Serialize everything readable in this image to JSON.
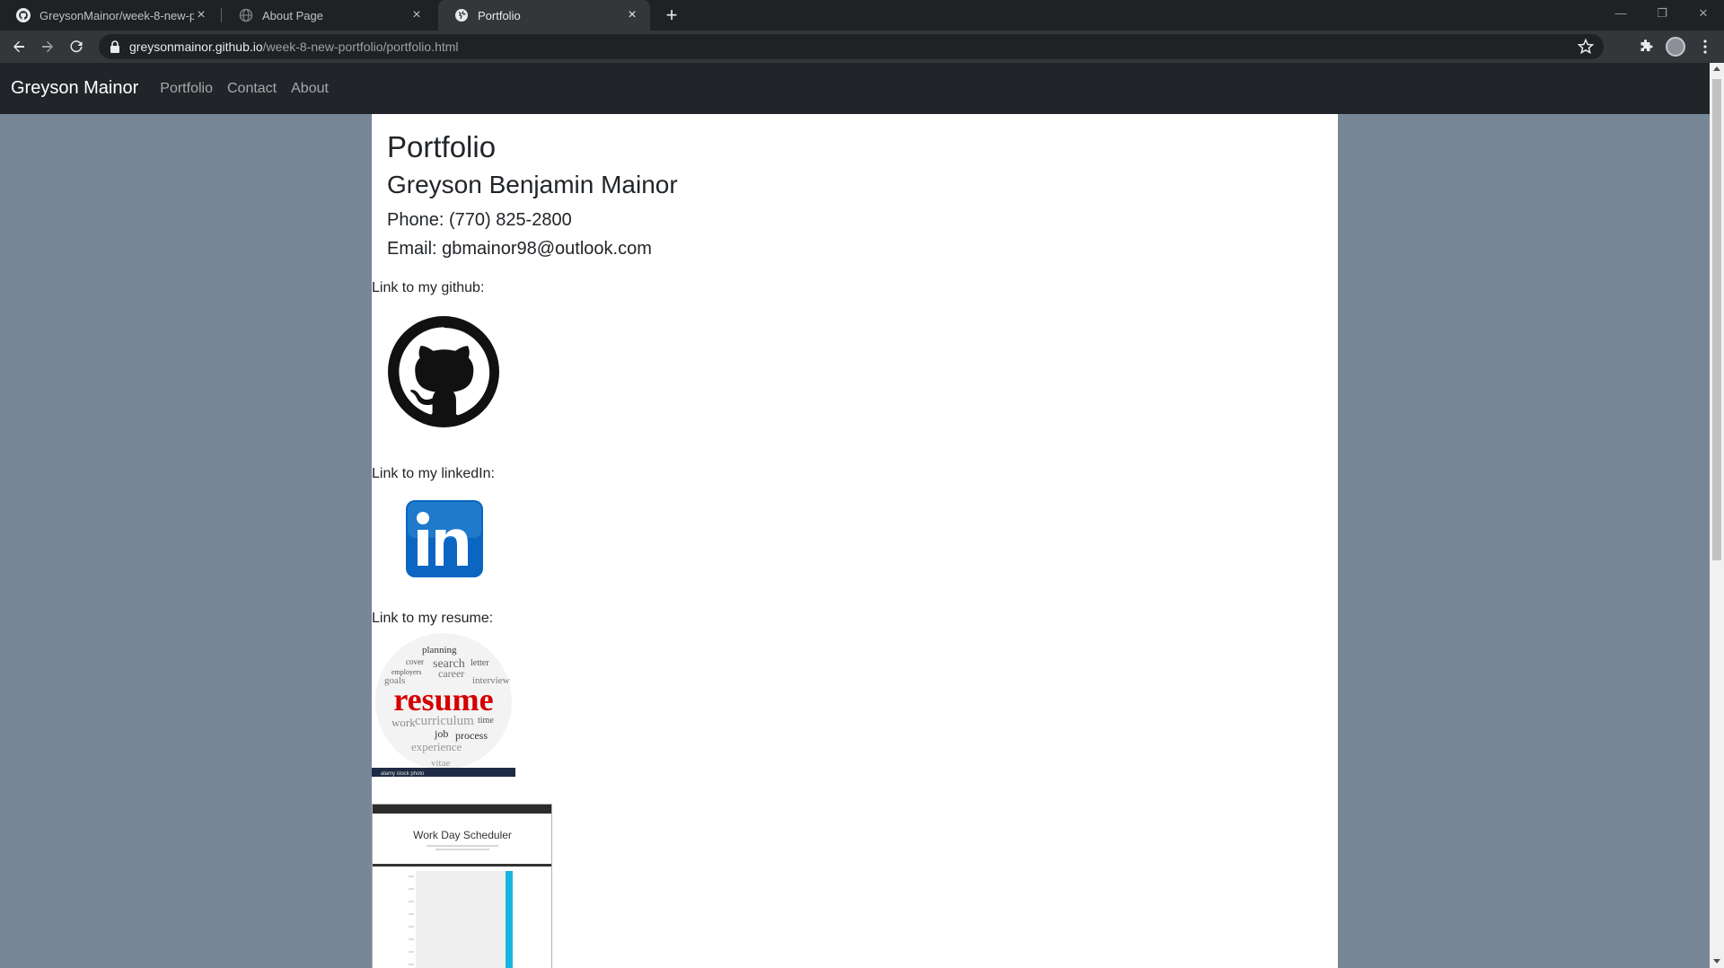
{
  "browser": {
    "tabs": [
      {
        "title": "GreysonMainor/week-8-new-portfolio",
        "icon": "github-icon"
      },
      {
        "title": "About Page",
        "icon": "globe-icon"
      },
      {
        "title": "Portfolio",
        "icon": "globe-icon"
      }
    ],
    "url_host": "greysonmainor.github.io",
    "url_path": "/week-8-new-portfolio/portfolio.html"
  },
  "nav": {
    "brand": "Greyson Mainor",
    "links": [
      "Portfolio",
      "Contact",
      "About"
    ]
  },
  "main": {
    "title": "Portfolio",
    "name": "Greyson Benjamin Mainor",
    "phone": "Phone: (770) 825-2800",
    "email": "Email: gbmainor98@outlook.com",
    "github_label": "Link to my github:",
    "linkedin_label": "Link to my linkedIn:",
    "resume_label": "Link to my resume:",
    "resume_img_text": "resume",
    "resume_watermark": "alamy stock photo",
    "scheduler_title": "Work Day Scheduler"
  },
  "colors": {
    "page_bg": "#778797",
    "navbar_bg": "#212529",
    "linkedin_blue": "#0a66c2",
    "resume_red": "#d40000",
    "scheduler_accent": "#17b6e0"
  }
}
